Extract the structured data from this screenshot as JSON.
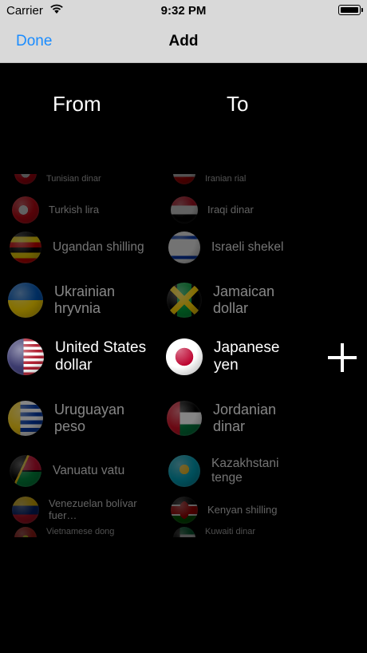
{
  "status_bar": {
    "carrier": "Carrier",
    "time": "9:32 PM"
  },
  "nav": {
    "done_label": "Done",
    "title": "Add"
  },
  "columns": {
    "from_label": "From",
    "to_label": "To"
  },
  "from_list": [
    {
      "label": "Tunisian dinar",
      "flag": "tunisia-flag"
    },
    {
      "label": "Turkish lira",
      "flag": "turkey-flag"
    },
    {
      "label": "Ugandan shilling",
      "flag": "uganda-flag"
    },
    {
      "label": "Ukrainian hryvnia",
      "flag": "ukraine-flag"
    },
    {
      "label": "United States dollar",
      "flag": "usa-flag",
      "selected": true
    },
    {
      "label": "Uruguayan peso",
      "flag": "uruguay-flag"
    },
    {
      "label": "Vanuatu vatu",
      "flag": "vanuatu-flag"
    },
    {
      "label": "Venezuelan bolívar fuer…",
      "flag": "venezuela-flag"
    },
    {
      "label": "Vietnamese dong",
      "flag": "vietnam-flag"
    }
  ],
  "to_list": [
    {
      "label": "Iranian rial",
      "flag": "iran-flag"
    },
    {
      "label": "Iraqi dinar",
      "flag": "iraq-flag"
    },
    {
      "label": "Israeli shekel",
      "flag": "israel-flag"
    },
    {
      "label": "Jamaican dollar",
      "flag": "jamaica-flag"
    },
    {
      "label": "Japanese yen",
      "flag": "japan-flag",
      "selected": true
    },
    {
      "label": "Jordanian dinar",
      "flag": "jordan-flag"
    },
    {
      "label": "Kazakhstani tenge",
      "flag": "kazakhstan-flag"
    },
    {
      "label": "Kenyan shilling",
      "flag": "kenya-flag"
    },
    {
      "label": "Kuwaiti dinar",
      "flag": "kuwait-flag"
    }
  ],
  "add_button_icon": "plus-icon"
}
